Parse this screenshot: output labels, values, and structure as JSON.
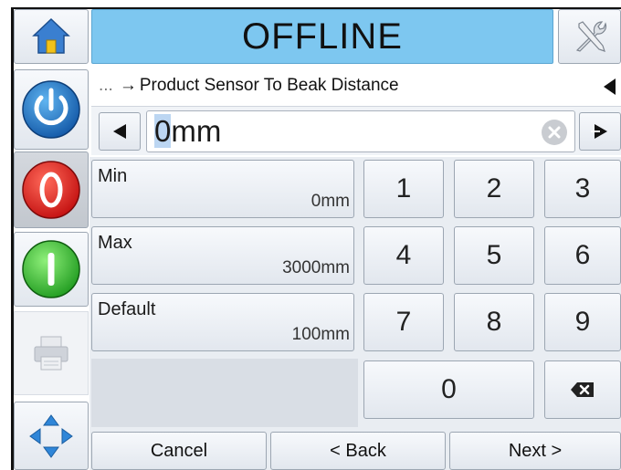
{
  "header": {
    "title": "OFFLINE"
  },
  "breadcrumb": {
    "prefix": "...",
    "arrow": "→",
    "text": "Product Sensor To Beak Distance"
  },
  "input": {
    "cursor_char": "0",
    "value_rest": "mm"
  },
  "info": [
    {
      "label": "Min",
      "value": "0mm"
    },
    {
      "label": "Max",
      "value": "3000mm"
    },
    {
      "label": "Default",
      "value": "100mm"
    }
  ],
  "keypad": {
    "k1": "1",
    "k2": "2",
    "k3": "3",
    "k4": "4",
    "k5": "5",
    "k6": "6",
    "k7": "7",
    "k8": "8",
    "k9": "9",
    "k0": "0"
  },
  "footer": {
    "cancel": "Cancel",
    "back": "< Back",
    "next": "Next >"
  },
  "colors": {
    "title_bg": "#7dc7f0",
    "power": "#1f78c8",
    "stop": "#e02020",
    "start": "#2fbf2f"
  },
  "icons": {
    "home": "home-icon",
    "tools": "tools-icon",
    "power": "power-icon",
    "stop": "stop-icon",
    "start": "start-icon",
    "print": "printer-icon",
    "nav": "navigate-arrows-icon"
  }
}
